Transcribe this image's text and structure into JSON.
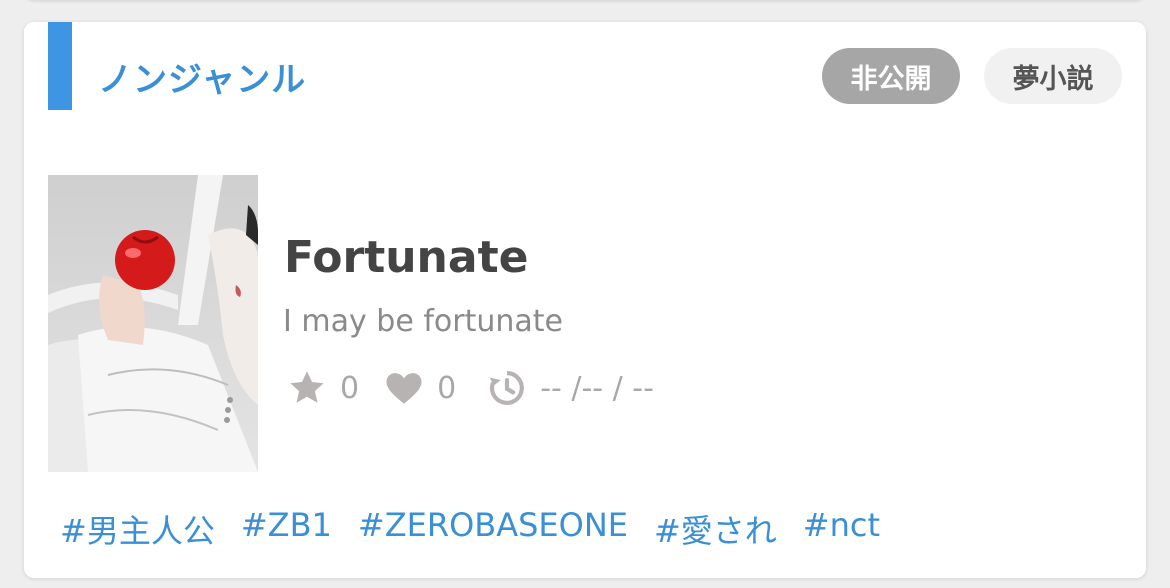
{
  "card": {
    "genre": "ノンジャンル",
    "badges": {
      "visibility": "非公開",
      "category": "夢小説"
    },
    "title": "Fortunate",
    "subtitle": "I may be fortunate",
    "stats": {
      "stars": "0",
      "likes": "0",
      "updated": "-- /-- / --"
    },
    "tags": [
      "#男主人公",
      "#ZB1",
      "#ZEROBASEONE",
      "#愛され",
      "#nct"
    ]
  },
  "colors": {
    "accent": "#3d95e3",
    "tag_text": "#3b8fd4",
    "badge_private_bg": "#a6a6a6",
    "badge_dream_bg": "#f1f1f1",
    "icon_gray": "#b8b3b3"
  },
  "icons": {
    "stars": "star-icon",
    "likes": "heart-icon",
    "updated": "history-clock-icon"
  }
}
